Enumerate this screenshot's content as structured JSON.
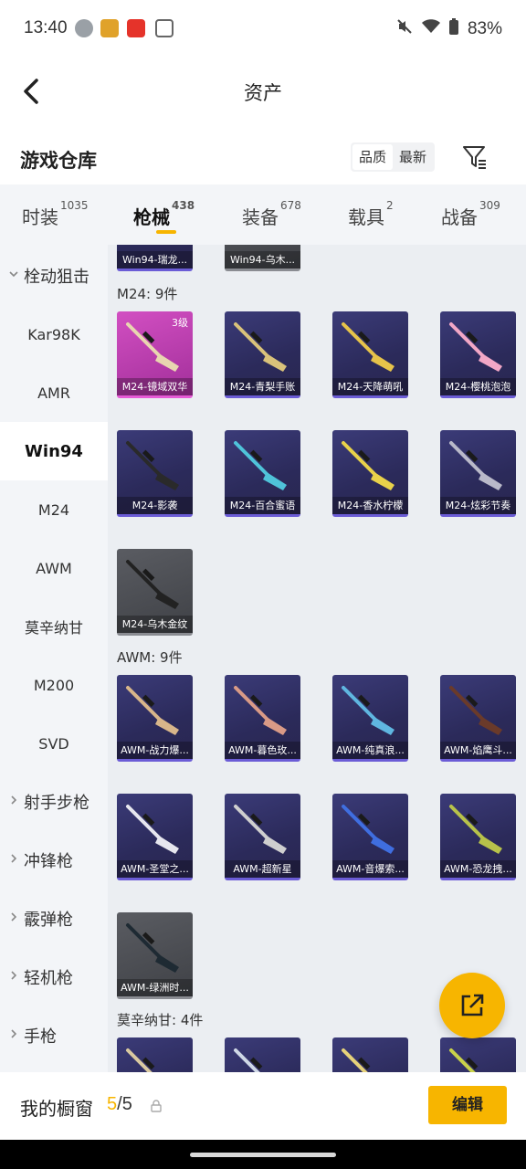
{
  "status_bar": {
    "time": "13:40",
    "battery": "83%",
    "icons": [
      "wechat-icon",
      "app-icon-burger",
      "app-icon-red",
      "phone-clean-icon",
      "mute-icon",
      "wifi-icon",
      "battery-icon"
    ]
  },
  "header": {
    "title": "资产",
    "back_icon": "chevron-left-icon"
  },
  "section": {
    "title": "游戏仓库",
    "sort_options": [
      "品质",
      "最新"
    ],
    "sort_active": "品质",
    "filter_icon": "filter-icon"
  },
  "tabs": [
    {
      "label": "时装",
      "count": "1035"
    },
    {
      "label": "枪械",
      "count": "438",
      "active": true
    },
    {
      "label": "装备",
      "count": "678"
    },
    {
      "label": "载具",
      "count": "2"
    },
    {
      "label": "战备",
      "count": "309"
    }
  ],
  "categories": [
    {
      "label": "栓动狙击",
      "type": "group",
      "expanded": true
    },
    {
      "label": "Kar98K"
    },
    {
      "label": "AMR"
    },
    {
      "label": "Win94",
      "selected": true
    },
    {
      "label": "M24"
    },
    {
      "label": "AWM"
    },
    {
      "label": "莫辛纳甘"
    },
    {
      "label": "M200"
    },
    {
      "label": "SVD"
    },
    {
      "label": "射手步枪",
      "type": "group"
    },
    {
      "label": "冲锋枪",
      "type": "group"
    },
    {
      "label": "霰弹枪",
      "type": "group"
    },
    {
      "label": "轻机枪",
      "type": "group"
    },
    {
      "label": "手枪",
      "type": "group"
    }
  ],
  "grid": {
    "top_partial_items": [
      "Win94-瑞龙...",
      "Win94-乌木..."
    ],
    "groups": [
      {
        "label": "M24: 9件",
        "items": [
          {
            "label": "M24-镜域双华",
            "tier": "3级",
            "style": "pink",
            "gun_color": "#e8d6b0"
          },
          {
            "label": "M24-青梨手账",
            "style": "purple",
            "gun_color": "#d9c27a"
          },
          {
            "label": "M24-天降萌吼",
            "style": "purple",
            "gun_color": "#e6c34a"
          },
          {
            "label": "M24-樱桃泡泡",
            "style": "purple",
            "gun_color": "#f2a7c6"
          },
          {
            "label": "M24-影袭",
            "style": "purple",
            "gun_color": "#2a2a2a"
          },
          {
            "label": "M24-百合蜜语",
            "style": "purple",
            "gun_color": "#4fc3d9"
          },
          {
            "label": "M24-香水柠檬",
            "style": "purple",
            "gun_color": "#e8d24a"
          },
          {
            "label": "M24-炫彩节奏",
            "style": "purple",
            "gun_color": "#b9b9c9"
          },
          {
            "label": "M24-乌木金纹",
            "style": "gray",
            "gun_color": "#222222"
          }
        ]
      },
      {
        "label": "AWM: 9件",
        "items": [
          {
            "label": "AWM-战力爆...",
            "style": "purple",
            "gun_color": "#d8b68a"
          },
          {
            "label": "AWM-暮色玫...",
            "style": "purple",
            "gun_color": "#d99a86"
          },
          {
            "label": "AWM-纯真浪...",
            "style": "purple",
            "gun_color": "#5fb6e0"
          },
          {
            "label": "AWM-焰鹰斗...",
            "style": "purple",
            "gun_color": "#6a3a2a"
          },
          {
            "label": "AWM-圣堂之...",
            "style": "purple",
            "gun_color": "#e6e6ee"
          },
          {
            "label": "AWM-超新星",
            "style": "purple",
            "gun_color": "#cfcfcf"
          },
          {
            "label": "AWM-音爆索...",
            "style": "purple",
            "gun_color": "#3f6ee0"
          },
          {
            "label": "AWM-恐龙拽...",
            "style": "purple",
            "gun_color": "#b7c24a"
          },
          {
            "label": "AWM-绿洲时...",
            "style": "gray",
            "gun_color": "#1e2a33"
          }
        ]
      },
      {
        "label": "莫辛纳甘: 4件",
        "items": [
          {
            "label": "",
            "style": "purple",
            "gun_color": "#d9c9a0"
          },
          {
            "label": "",
            "style": "purple",
            "gun_color": "#cfd8e6"
          },
          {
            "label": "",
            "style": "purple",
            "gun_color": "#e6d27a"
          },
          {
            "label": "",
            "style": "purple",
            "gun_color": "#c9d24a"
          }
        ]
      }
    ]
  },
  "fab": {
    "icon": "external-share-icon"
  },
  "bottom_bar": {
    "label": "我的橱窗",
    "current": "5",
    "separator": "/",
    "total": "5",
    "lock_icon": "lock-icon",
    "edit_label": "编辑"
  },
  "colors": {
    "accent": "#f7b500",
    "card_purple": "#2b2a5a",
    "card_pink": "#c23fb5",
    "card_gray": "#4a4c51"
  }
}
